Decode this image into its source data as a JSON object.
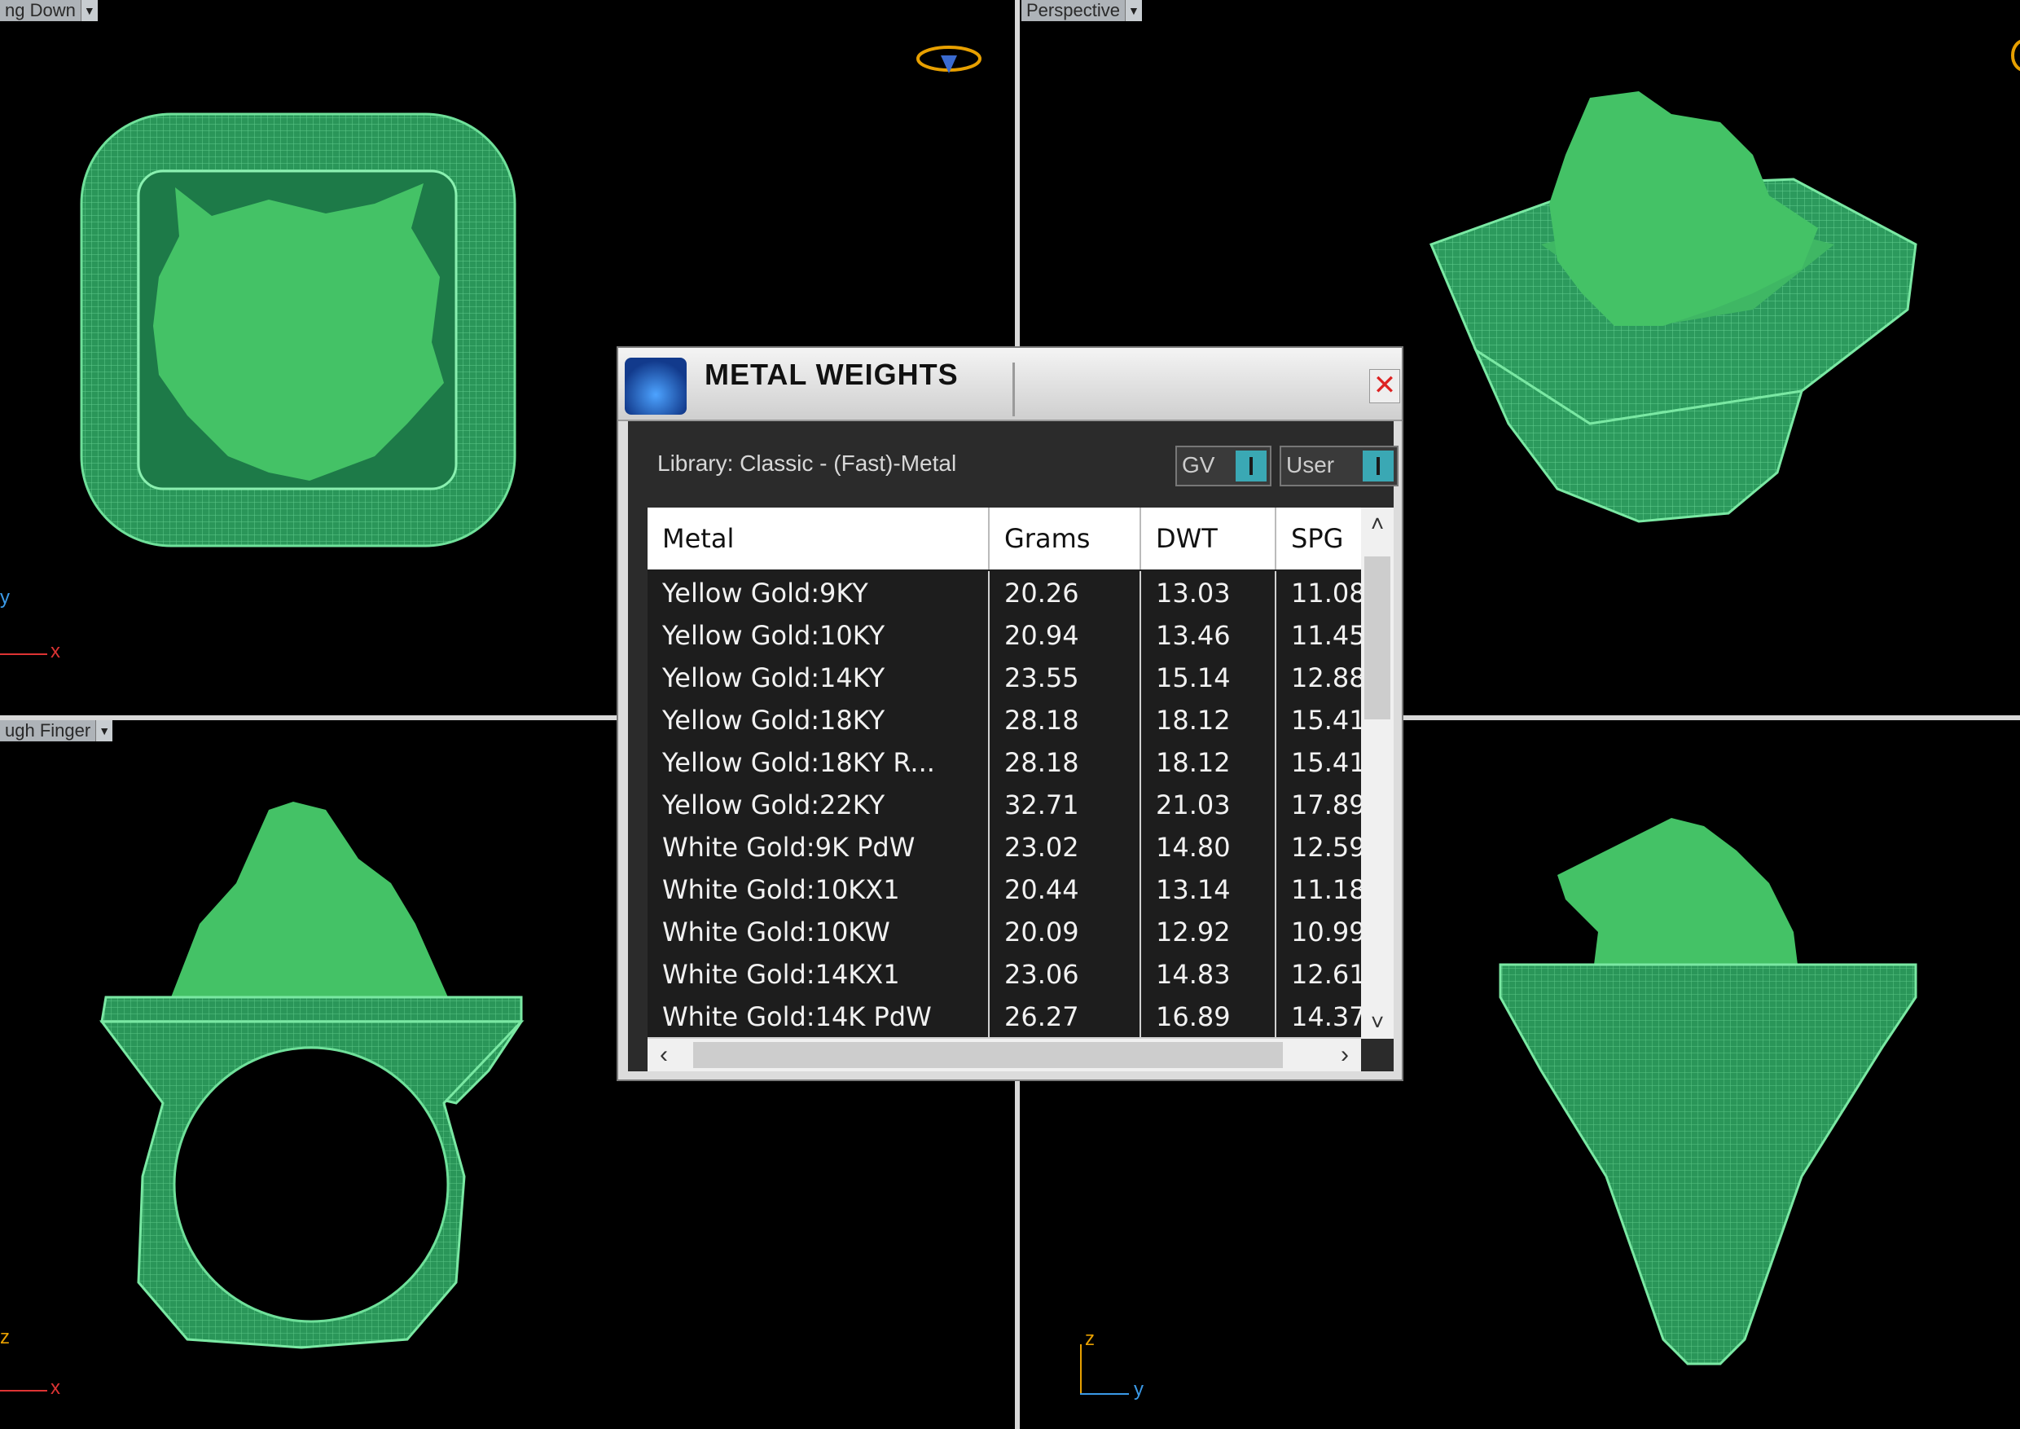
{
  "viewports": {
    "top_left_label": "ng Down",
    "top_right_label": "Perspective",
    "bottom_left_label": "ugh Finger"
  },
  "axes": {
    "tl_y": "y",
    "tl_x": "x",
    "bl_z": "z",
    "bl_x": "x",
    "br_z": "z",
    "br_y": "y"
  },
  "dialog": {
    "title": "METAL WEIGHTS",
    "close_glyph": "✕",
    "library": "Library: Classic - (Fast)-Metal",
    "toggle_gv": "GV",
    "toggle_user": "User",
    "columns": [
      "Metal",
      "Grams",
      "DWT",
      "SPG"
    ],
    "rows": [
      [
        "Yellow Gold:9KY",
        "20.26",
        "13.03",
        "11.08"
      ],
      [
        "Yellow Gold:10KY",
        "20.94",
        "13.46",
        "11.45"
      ],
      [
        "Yellow Gold:14KY",
        "23.55",
        "15.14",
        "12.88"
      ],
      [
        "Yellow Gold:18KY",
        "28.18",
        "18.12",
        "15.41"
      ],
      [
        "Yellow Gold:18KY R...",
        "28.18",
        "18.12",
        "15.41"
      ],
      [
        "Yellow Gold:22KY",
        "32.71",
        "21.03",
        "17.89"
      ],
      [
        "White Gold:9K PdW",
        "23.02",
        "14.80",
        "12.59"
      ],
      [
        "White Gold:10KX1",
        "20.44",
        "13.14",
        "11.18"
      ],
      [
        "White Gold:10KW",
        "20.09",
        "12.92",
        "10.99"
      ],
      [
        "White Gold:14KX1",
        "23.06",
        "14.83",
        "12.61"
      ],
      [
        "White Gold:14K PdW",
        "26.27",
        "16.89",
        "14.37"
      ]
    ],
    "scroll": {
      "up": "˄",
      "down": "˅",
      "left": "‹",
      "right": "›"
    }
  },
  "colors": {
    "model_green": "#2e9e5f",
    "stone_green": "#44c266",
    "dialog_bg": "#dcdcdc"
  }
}
